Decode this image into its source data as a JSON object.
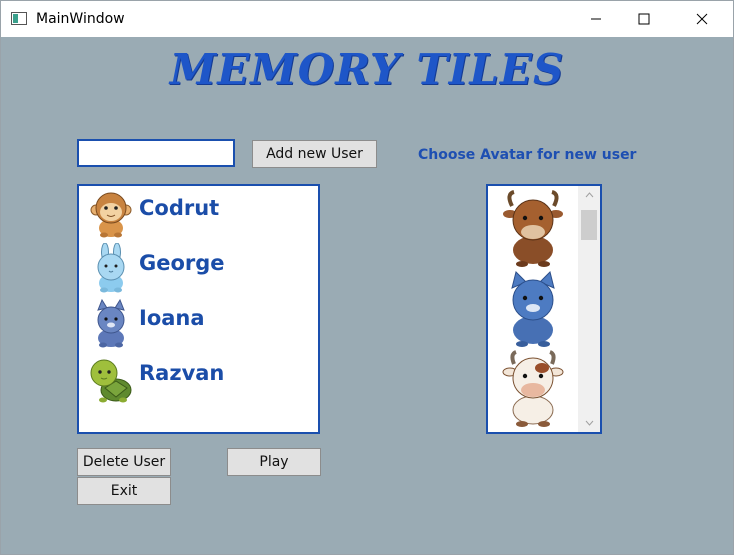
{
  "window": {
    "title": "MainWindow"
  },
  "app": {
    "title": "MEMORY TILES"
  },
  "form": {
    "username_value": "",
    "add_button_label": "Add new User",
    "avatar_label": "Choose Avatar for new user"
  },
  "users": [
    {
      "name": "Codrut",
      "avatar": "monkey-icon"
    },
    {
      "name": "George",
      "avatar": "bunny-icon"
    },
    {
      "name": "Ioana",
      "avatar": "cat-icon"
    },
    {
      "name": "Razvan",
      "avatar": "turtle-icon"
    }
  ],
  "avatars": [
    {
      "name": "bull-icon"
    },
    {
      "name": "blue-cat-icon"
    },
    {
      "name": "cow-icon"
    }
  ],
  "buttons": {
    "delete_label": "Delete User",
    "play_label": "Play",
    "exit_label": "Exit"
  },
  "colors": {
    "accent": "#1e56c8",
    "background": "#9aabb4",
    "list_border": "#1a4fae"
  }
}
